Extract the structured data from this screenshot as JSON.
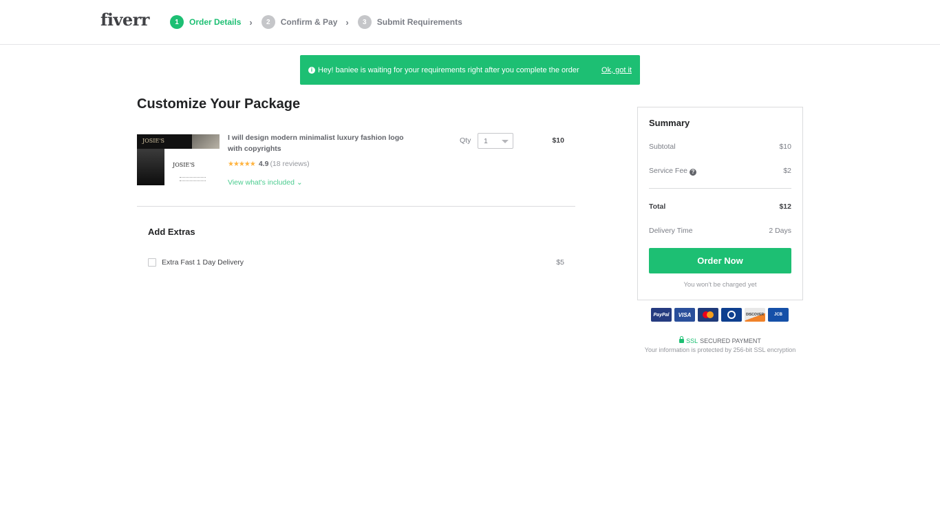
{
  "header": {
    "logo": "fiverr",
    "steps": [
      {
        "num": "1",
        "label": "Order Details",
        "active": true
      },
      {
        "num": "2",
        "label": "Confirm & Pay",
        "active": false
      },
      {
        "num": "3",
        "label": "Submit Requirements",
        "active": false
      }
    ],
    "step_separator": "›"
  },
  "banner": {
    "icon": "info-icon",
    "info_glyph": "i",
    "message": "Hey! baniee is waiting for your requirements right after you complete the order",
    "dismiss_label": "Ok, got it"
  },
  "main": {
    "title": "Customize Your Package",
    "gig": {
      "image_brand": "JOSIE'S",
      "title": "I will design modern minimalist luxury fashion logo with copyrights",
      "stars": "★★★★★",
      "rating": "4.9",
      "reviews": "(18 reviews)",
      "included_link": "View what's included ⌄",
      "qty_label": "Qty",
      "qty_value": "1",
      "price": "$10"
    },
    "extras": {
      "title": "Add Extras",
      "items": [
        {
          "label": "Extra Fast 1 Day Delivery",
          "price": "$5",
          "checked": false
        }
      ]
    }
  },
  "summary": {
    "title": "Summary",
    "subtotal_label": "Subtotal",
    "subtotal_value": "$10",
    "service_fee_label": "Service Fee",
    "service_fee_help": "?",
    "service_fee_value": "$2",
    "total_label": "Total",
    "total_value": "$12",
    "delivery_label": "Delivery Time",
    "delivery_value": "2 Days",
    "order_button": "Order Now",
    "note": "You won't be charged yet"
  },
  "payment": {
    "cards": [
      {
        "name": "paypal",
        "label": "PayPal"
      },
      {
        "name": "visa",
        "label": "VISA"
      },
      {
        "name": "mastercard",
        "label": ""
      },
      {
        "name": "diners",
        "label": ""
      },
      {
        "name": "discover",
        "label": "DISCOVER"
      },
      {
        "name": "jcb",
        "label": "JCB"
      }
    ],
    "ssl_label": "SSL",
    "secured_label": "SECURED PAYMENT",
    "ssl_note": "Your information is protected by 256-bit SSL encryption"
  },
  "colors": {
    "brand_green": "#1dbf73",
    "text_dark": "#222325",
    "star": "#ffb33e"
  }
}
